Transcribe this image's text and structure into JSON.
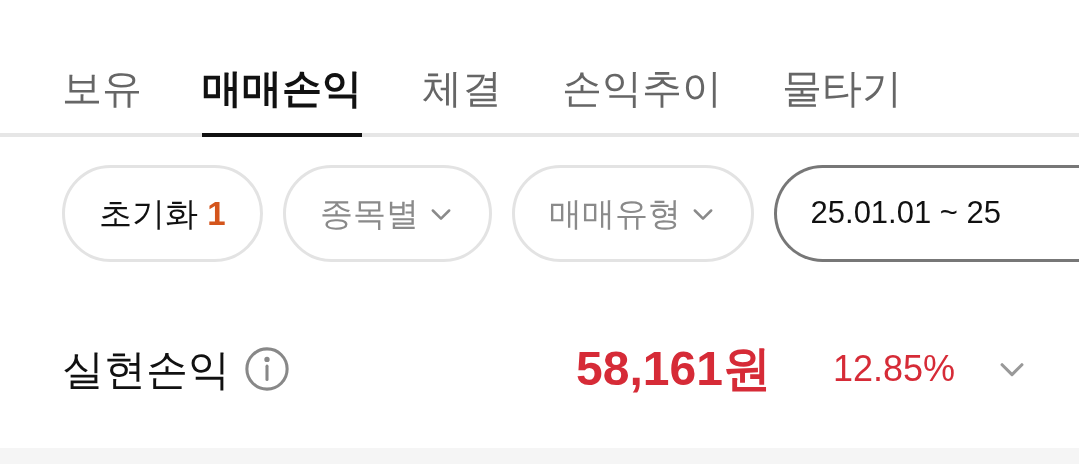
{
  "tabs": [
    {
      "label": "보유",
      "selected": false
    },
    {
      "label": "매매손익",
      "selected": true
    },
    {
      "label": "체결",
      "selected": false
    },
    {
      "label": "손익추이",
      "selected": false
    },
    {
      "label": "물타기",
      "selected": false
    }
  ],
  "filters": [
    {
      "kind": "reset",
      "label": "초기화",
      "count": "1"
    },
    {
      "kind": "dropdown",
      "label": "종목별"
    },
    {
      "kind": "dropdown",
      "label": "매매유형"
    },
    {
      "kind": "date",
      "label": "25.01.01 ~ 25"
    }
  ],
  "summary": {
    "label": "실현손익",
    "amount": "58,161원",
    "rate": "12.85%",
    "expanded": false
  }
}
